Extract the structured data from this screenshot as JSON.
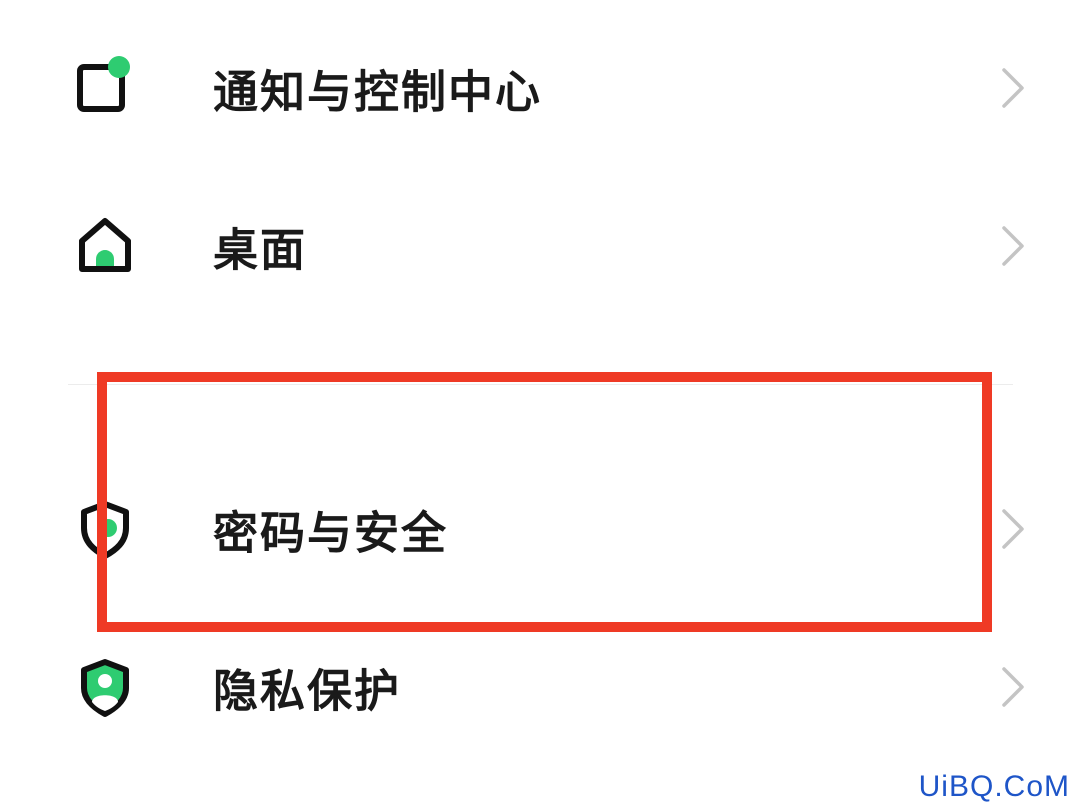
{
  "settings": {
    "items": [
      {
        "id": "notify",
        "label": "通知与控制中心",
        "icon": "notification-center-icon"
      },
      {
        "id": "desktop",
        "label": "桌面",
        "icon": "home-icon"
      },
      {
        "id": "password",
        "label": "密码与安全",
        "icon": "shield-security-icon"
      },
      {
        "id": "privacy",
        "label": "隐私保护",
        "icon": "shield-user-icon"
      }
    ]
  },
  "watermark": "UiBQ.CoM",
  "colors": {
    "accent": "#2ecc71",
    "text": "#1a1a1a",
    "chevron": "#c4c4c4",
    "highlight": "#ef3a25",
    "watermark": "#1e55c8"
  }
}
